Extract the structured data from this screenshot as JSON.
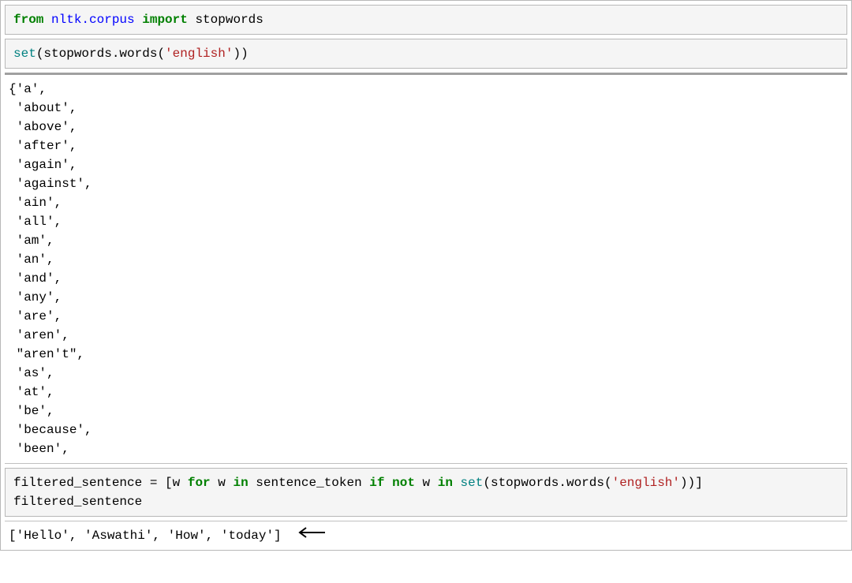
{
  "cell1": {
    "tokens": [
      {
        "t": "from ",
        "cls": "kw-green"
      },
      {
        "t": "nltk.corpus ",
        "cls": "kw-blue"
      },
      {
        "t": "import ",
        "cls": "kw-green"
      },
      {
        "t": "stopwords",
        "cls": "plain"
      }
    ]
  },
  "cell2": {
    "tokens": [
      {
        "t": "set",
        "cls": "fn-teal"
      },
      {
        "t": "(stopwords.words(",
        "cls": "plain"
      },
      {
        "t": "'english'",
        "cls": "str-red"
      },
      {
        "t": "))",
        "cls": "plain"
      }
    ]
  },
  "output1": {
    "lines": [
      "{'a',",
      " 'about',",
      " 'above',",
      " 'after',",
      " 'again',",
      " 'against',",
      " 'ain',",
      " 'all',",
      " 'am',",
      " 'an',",
      " 'and',",
      " 'any',",
      " 'are',",
      " 'aren',",
      " \"aren't\",",
      " 'as',",
      " 'at',",
      " 'be',",
      " 'because',",
      " 'been',"
    ]
  },
  "cell3": {
    "line1_tokens": [
      {
        "t": "filtered_sentence = [w ",
        "cls": "plain"
      },
      {
        "t": "for",
        "cls": "kw-green"
      },
      {
        "t": " w ",
        "cls": "plain"
      },
      {
        "t": "in",
        "cls": "kw-green"
      },
      {
        "t": " sentence_token ",
        "cls": "plain"
      },
      {
        "t": "if",
        "cls": "kw-green"
      },
      {
        "t": " ",
        "cls": "plain"
      },
      {
        "t": "not",
        "cls": "kw-green"
      },
      {
        "t": " w ",
        "cls": "plain"
      },
      {
        "t": "in",
        "cls": "kw-green"
      },
      {
        "t": " ",
        "cls": "plain"
      },
      {
        "t": "set",
        "cls": "fn-teal"
      },
      {
        "t": "(stopwords.words(",
        "cls": "plain"
      },
      {
        "t": "'english'",
        "cls": "str-red"
      },
      {
        "t": "))]",
        "cls": "plain"
      }
    ],
    "line2": "filtered_sentence"
  },
  "output2": {
    "text": "['Hello', 'Aswathi', 'How', 'today']"
  }
}
